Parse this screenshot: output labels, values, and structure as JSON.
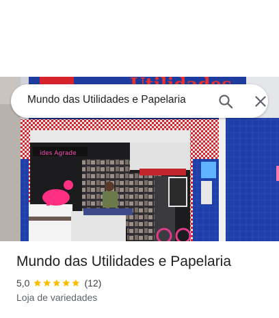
{
  "search": {
    "query": "Mundo das Utilidades e Papelaria"
  },
  "icons": {
    "search": "search-icon",
    "close": "close-icon",
    "star": "star-icon"
  },
  "storefront_sign": {
    "main_text": "Utilidades",
    "inner_sign_text": "ides Agrade"
  },
  "place": {
    "name": "Mundo das Utilidades e Papelaria",
    "rating": "5,0",
    "stars": 5,
    "review_count": "(12)",
    "category": "Loja de variedades"
  },
  "colors": {
    "star": "#fbbc04",
    "tile_blue": "#1f3fa8",
    "tile_red": "#d6222b",
    "sign_blue": "#1e3c9e"
  }
}
